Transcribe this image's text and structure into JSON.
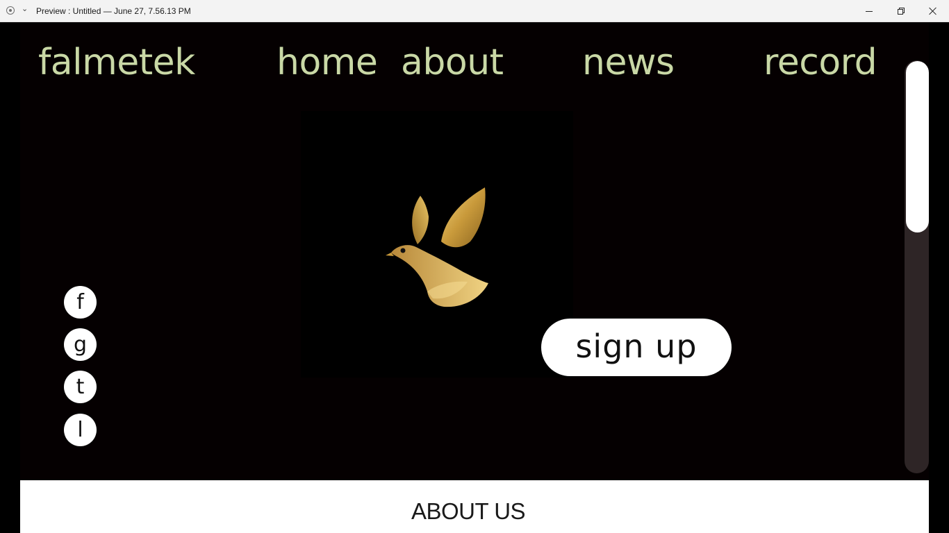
{
  "window": {
    "title": "Preview : Untitled — June 27, 7.56.13 PM",
    "minimize_icon": "minimize-icon",
    "maximize_icon": "restore-icon",
    "close_icon": "close-icon"
  },
  "header": {
    "brand": "falmetek",
    "nav": [
      {
        "label": "home"
      },
      {
        "label": "about"
      },
      {
        "label": "news"
      },
      {
        "label": "record"
      }
    ],
    "link_color": "#c9d8a6"
  },
  "hero": {
    "logo_icon": "golden-bird-icon",
    "signup_label": "sign up",
    "background": "#050001"
  },
  "social": [
    {
      "label": "f"
    },
    {
      "label": "g"
    },
    {
      "label": "t"
    },
    {
      "label": "l"
    }
  ],
  "about": {
    "title": "ABOUT US"
  },
  "scrollbar": {
    "position_fraction": 0.0
  }
}
